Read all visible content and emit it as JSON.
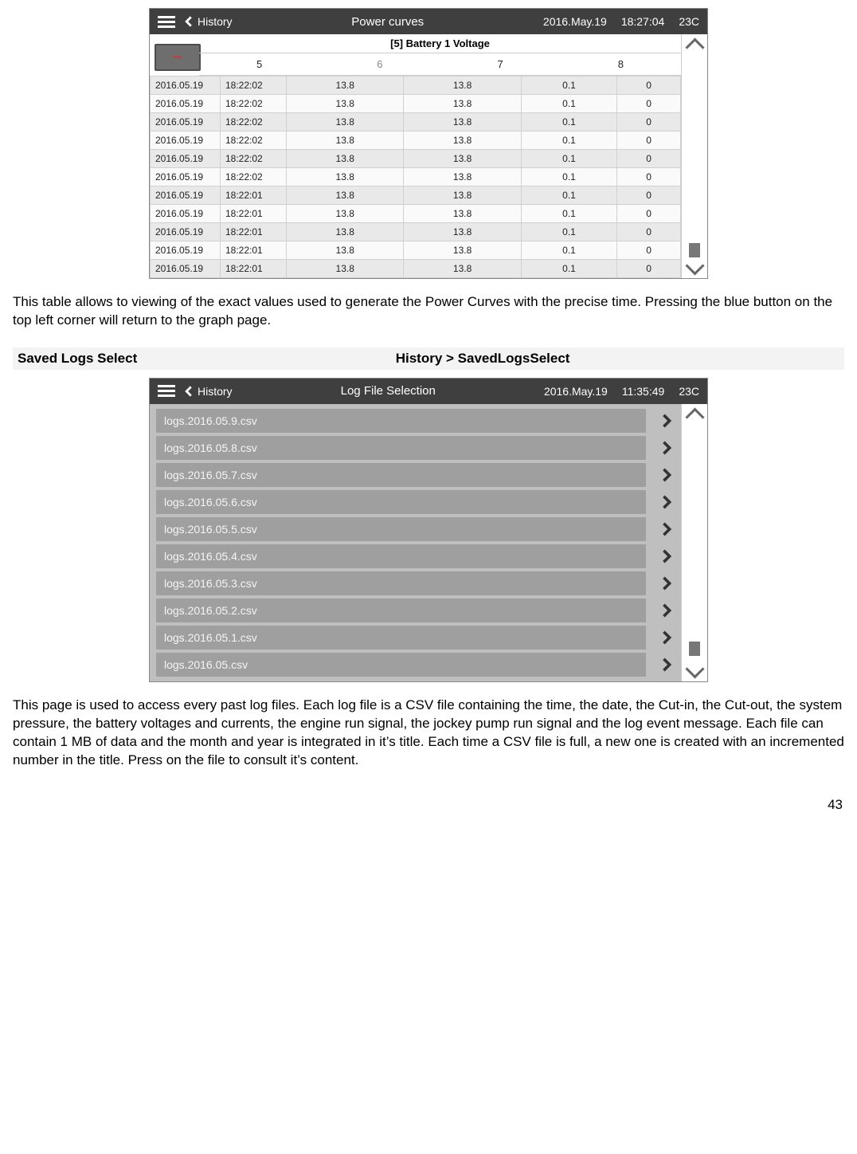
{
  "shot1": {
    "topbar": {
      "back_label": "History",
      "title": "Power curves",
      "date": "2016.May.19",
      "time": "18:27:04",
      "temp": "23C"
    },
    "subtitle": "[5] Battery 1 Voltage",
    "cols": [
      "5",
      "6",
      "7",
      "8"
    ],
    "selected_col_index": 1,
    "rows": [
      {
        "date": "2016.05.19",
        "time": "18:22:02",
        "v": [
          "13.8",
          "13.8",
          "0.1",
          "0"
        ]
      },
      {
        "date": "2016.05.19",
        "time": "18:22:02",
        "v": [
          "13.8",
          "13.8",
          "0.1",
          "0"
        ]
      },
      {
        "date": "2016.05.19",
        "time": "18:22:02",
        "v": [
          "13.8",
          "13.8",
          "0.1",
          "0"
        ]
      },
      {
        "date": "2016.05.19",
        "time": "18:22:02",
        "v": [
          "13.8",
          "13.8",
          "0.1",
          "0"
        ]
      },
      {
        "date": "2016.05.19",
        "time": "18:22:02",
        "v": [
          "13.8",
          "13.8",
          "0.1",
          "0"
        ]
      },
      {
        "date": "2016.05.19",
        "time": "18:22:02",
        "v": [
          "13.8",
          "13.8",
          "0.1",
          "0"
        ]
      },
      {
        "date": "2016.05.19",
        "time": "18:22:01",
        "v": [
          "13.8",
          "13.8",
          "0.1",
          "0"
        ]
      },
      {
        "date": "2016.05.19",
        "time": "18:22:01",
        "v": [
          "13.8",
          "13.8",
          "0.1",
          "0"
        ]
      },
      {
        "date": "2016.05.19",
        "time": "18:22:01",
        "v": [
          "13.8",
          "13.8",
          "0.1",
          "0"
        ]
      },
      {
        "date": "2016.05.19",
        "time": "18:22:01",
        "v": [
          "13.8",
          "13.8",
          "0.1",
          "0"
        ]
      },
      {
        "date": "2016.05.19",
        "time": "18:22:01",
        "v": [
          "13.8",
          "13.8",
          "0.1",
          "0"
        ]
      }
    ]
  },
  "para1": "This table allows to viewing of the exact values used to generate the Power Curves with the precise time. Pressing the blue button on the top left corner will return to the graph page.",
  "section2": {
    "left": "Saved Logs Select",
    "right": "History > SavedLogsSelect"
  },
  "shot2": {
    "topbar": {
      "back_label": "History",
      "title": "Log File Selection",
      "date": "2016.May.19",
      "time": "11:35:49",
      "temp": "23C"
    },
    "files": [
      "logs.2016.05.9.csv",
      "logs.2016.05.8.csv",
      "logs.2016.05.7.csv",
      "logs.2016.05.6.csv",
      "logs.2016.05.5.csv",
      "logs.2016.05.4.csv",
      "logs.2016.05.3.csv",
      "logs.2016.05.2.csv",
      "logs.2016.05.1.csv",
      "logs.2016.05.csv"
    ]
  },
  "para2": "This page is used to access every past log files. Each log file is a CSV file containing the time, the date, the Cut-in, the Cut-out, the system pressure, the battery voltages and currents, the engine run signal, the jockey pump run signal and the log event message. Each file can contain 1 MB of data and the month and year is integrated in it’s title. Each time a CSV file is full, a new one is created with an incremented number in the title. Press on the file to consult it’s content.",
  "page_number": "43"
}
